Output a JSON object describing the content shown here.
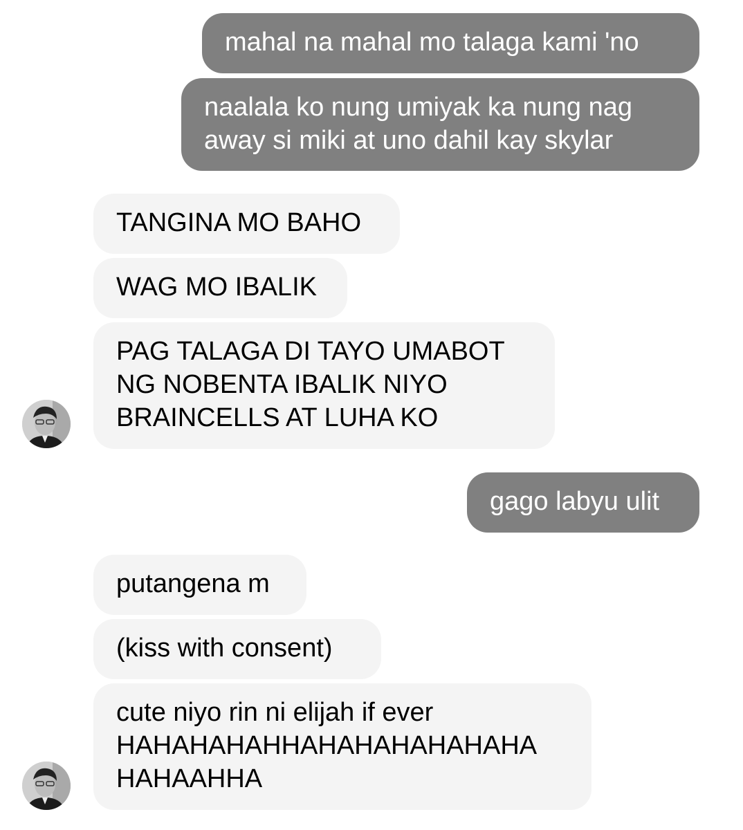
{
  "conversation": {
    "messages": [
      {
        "sender": "me",
        "text": "mahal na mahal mo talaga kami 'no"
      },
      {
        "sender": "me",
        "text": "naalala ko nung umiyak ka nung nag\naway si miki at uno dahil kay skylar"
      },
      {
        "sender": "them",
        "text": "TANGINA MO BAHO"
      },
      {
        "sender": "them",
        "text": "WAG MO IBALIK"
      },
      {
        "sender": "them",
        "text": "PAG TALAGA DI TAYO UMABOT\nNG NOBENTA IBALIK NIYO\nBRAINCELLS AT LUHA KO"
      },
      {
        "sender": "me",
        "text": "gago labyu ulit"
      },
      {
        "sender": "them",
        "text": "putangena m"
      },
      {
        "sender": "them",
        "text": "(kiss with consent)"
      },
      {
        "sender": "them",
        "text": "cute niyo rin ni elijah if ever\nHAHAHAHAHHAHAHAHAHAHAHA\nHAHAAHHA"
      }
    ]
  },
  "avatar_icon": "person-photo-icon",
  "colors": {
    "outgoing_bubble": "#808080",
    "incoming_bubble": "#f4f4f4",
    "outgoing_text": "#ffffff",
    "incoming_text": "#000000",
    "background": "#ffffff"
  }
}
